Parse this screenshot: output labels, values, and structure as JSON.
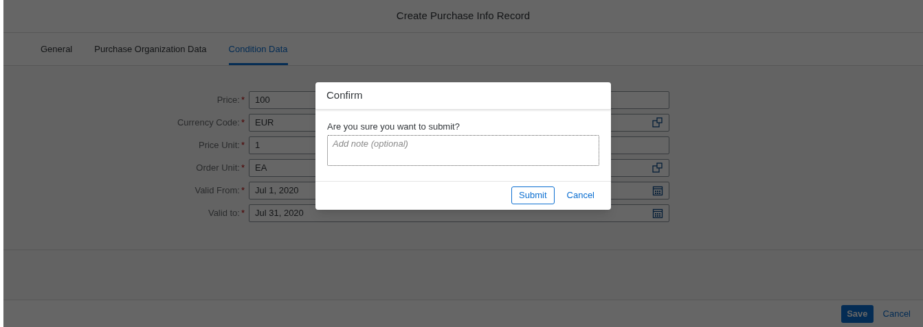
{
  "window": {
    "title": "Create Purchase Info Record"
  },
  "tabs": [
    {
      "label": "General",
      "selected": false
    },
    {
      "label": "Purchase Organization Data",
      "selected": false
    },
    {
      "label": "Condition Data",
      "selected": true
    }
  ],
  "fields": [
    {
      "label": "Price:",
      "required_mark": "*",
      "value": "100",
      "kind": "plain"
    },
    {
      "label": "Currency Code:",
      "required_mark": "*",
      "value": "EUR",
      "kind": "value_help"
    },
    {
      "label": "Price Unit:",
      "required_mark": "*",
      "value": "1",
      "kind": "plain"
    },
    {
      "label": "Order Unit:",
      "required_mark": "*",
      "value": "EA",
      "kind": "value_help"
    },
    {
      "label": "Valid From:",
      "required_mark": "*",
      "value": "Jul 1, 2020",
      "kind": "date"
    },
    {
      "label": "Valid to:",
      "required_mark": "*",
      "value": "Jul 31, 2020",
      "kind": "date"
    }
  ],
  "footer": {
    "save": "Save",
    "cancel": "Cancel"
  },
  "dialog": {
    "title": "Confirm",
    "message": "Are you sure you want to submit?",
    "note": {
      "placeholder": "Add note (optional)"
    },
    "submit": "Submit",
    "cancel": "Cancel"
  }
}
